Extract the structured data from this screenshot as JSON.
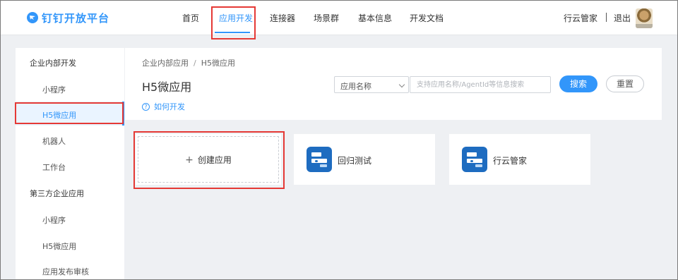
{
  "header": {
    "brand": "钉钉开放平台",
    "nav": [
      "首页",
      "应用开发",
      "连接器",
      "场景群",
      "基本信息",
      "开发文档"
    ],
    "active_nav": "应用开发",
    "user_name": "行云管家",
    "logout": "退出"
  },
  "sidebar": {
    "sections": [
      {
        "title": "企业内部开发",
        "items": [
          "小程序",
          "H5微应用",
          "机器人",
          "工作台"
        ]
      },
      {
        "title": "第三方企业应用",
        "items": [
          "小程序",
          "H5微应用",
          "应用发布审核"
        ]
      }
    ],
    "active_item": "H5微应用"
  },
  "main": {
    "breadcrumb": [
      "企业内部应用",
      "H5微应用"
    ],
    "title": "H5微应用",
    "help_link": "如何开发",
    "filter_select": "应用名称",
    "search_placeholder": "支持应用名称/AgentId等信息搜索",
    "search_button": "搜索",
    "reset_button": "重置"
  },
  "cards": {
    "create_label": "创建应用",
    "apps": [
      "回归测试",
      "行云管家"
    ]
  },
  "colors": {
    "accent": "#3296fa",
    "highlight_box": "#e53935",
    "app_icon": "#1e6cc0"
  }
}
